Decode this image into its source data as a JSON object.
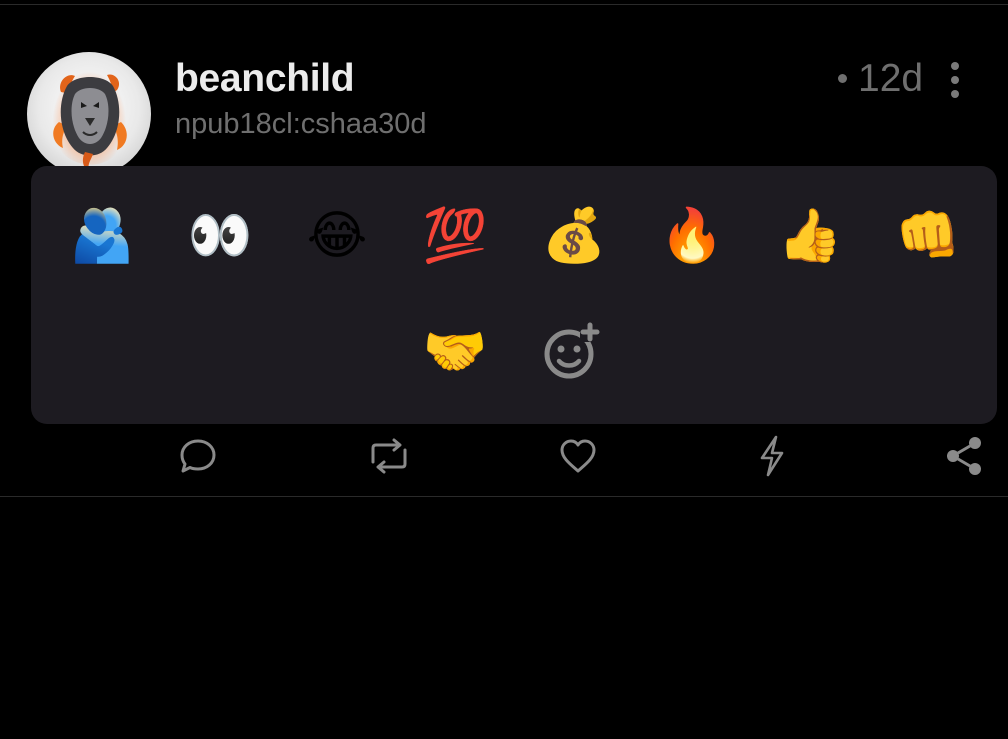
{
  "post": {
    "author_name": "beanchild",
    "author_npub": "npub18cl:cshaa30d",
    "time": "12d",
    "avatar_icon": "lion-avatar"
  },
  "reaction_picker": {
    "emojis": [
      {
        "name": "people-hugging",
        "char": "🫂"
      },
      {
        "name": "eyes",
        "char": "👀"
      },
      {
        "name": "face-with-tears-of-joy",
        "char": "😂"
      },
      {
        "name": "hundred-points",
        "char": "💯"
      },
      {
        "name": "money-bag",
        "char": "💰"
      },
      {
        "name": "fire",
        "char": "🔥"
      },
      {
        "name": "thumbs-up",
        "char": "👍"
      },
      {
        "name": "oncoming-fist",
        "char": "👊"
      },
      {
        "name": "handshake",
        "char": "🤝"
      }
    ],
    "add_icon": "add-reaction-icon"
  },
  "actions": {
    "icons": [
      "reply-icon",
      "repost-icon",
      "like-icon",
      "zap-icon",
      "share-icon"
    ]
  },
  "colors": {
    "background": "#000000",
    "panel": "#1d1b21",
    "text_primary": "#ececec",
    "text_secondary": "#6f6f6f",
    "icon": "#8a8a8a"
  }
}
